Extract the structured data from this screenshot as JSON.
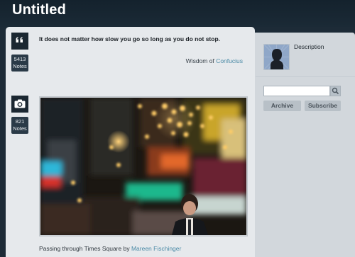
{
  "header": {
    "title": "Untitled"
  },
  "posts": [
    {
      "type": "quote",
      "icon": "quote-icon",
      "notes_count": "5413",
      "notes_label": "Notes",
      "quote": "It does not matter how slow you go so long as you do not stop.",
      "source_prefix": "Wisdom of",
      "source_link": "Confucius"
    },
    {
      "type": "photo",
      "icon": "camera-icon",
      "notes_count": "821",
      "notes_label": "Notes",
      "caption_prefix": "Passing through Times Square by",
      "caption_link": "Mareen Fischinger"
    }
  ],
  "sidebar": {
    "description": "Description",
    "search_placeholder": "",
    "archive_label": "Archive",
    "subscribe_label": "Subscribe"
  },
  "colors": {
    "background": "#1d2b37",
    "content": "#e6e9ec",
    "sidebar": "#d2d7dc",
    "link": "#4a8aa6"
  }
}
